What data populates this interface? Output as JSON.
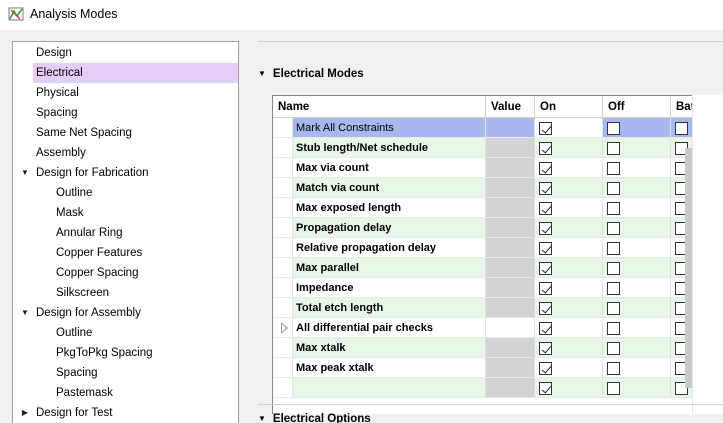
{
  "window": {
    "title": "Analysis Modes"
  },
  "tree": {
    "items": [
      {
        "label": "Design",
        "level": 0,
        "toggle": "",
        "selected": false
      },
      {
        "label": "Electrical",
        "level": 0,
        "toggle": "",
        "selected": true
      },
      {
        "label": "Physical",
        "level": 0,
        "toggle": "",
        "selected": false
      },
      {
        "label": "Spacing",
        "level": 0,
        "toggle": "",
        "selected": false
      },
      {
        "label": "Same Net Spacing",
        "level": 0,
        "toggle": "",
        "selected": false
      },
      {
        "label": "Assembly",
        "level": 0,
        "toggle": "",
        "selected": false
      },
      {
        "label": "Design for Fabrication",
        "level": 0,
        "toggle": "expanded",
        "selected": false
      },
      {
        "label": "Outline",
        "level": 1,
        "toggle": "",
        "selected": false
      },
      {
        "label": "Mask",
        "level": 1,
        "toggle": "",
        "selected": false
      },
      {
        "label": "Annular Ring",
        "level": 1,
        "toggle": "",
        "selected": false
      },
      {
        "label": "Copper Features",
        "level": 1,
        "toggle": "",
        "selected": false
      },
      {
        "label": "Copper Spacing",
        "level": 1,
        "toggle": "",
        "selected": false
      },
      {
        "label": "Silkscreen",
        "level": 1,
        "toggle": "",
        "selected": false
      },
      {
        "label": "Design for Assembly",
        "level": 0,
        "toggle": "expanded",
        "selected": false
      },
      {
        "label": "Outline",
        "level": 1,
        "toggle": "",
        "selected": false
      },
      {
        "label": "PkgToPkg Spacing",
        "level": 1,
        "toggle": "",
        "selected": false
      },
      {
        "label": "Spacing",
        "level": 1,
        "toggle": "",
        "selected": false
      },
      {
        "label": "Pastemask",
        "level": 1,
        "toggle": "",
        "selected": false
      },
      {
        "label": "Design for Test",
        "level": 0,
        "toggle": "collapsed",
        "selected": false
      }
    ]
  },
  "sections": {
    "modes_title": "Electrical Modes",
    "options_title": "Electrical Options"
  },
  "grid": {
    "columns": [
      "Name",
      "Value",
      "On",
      "Off",
      "Bat"
    ],
    "rows": [
      {
        "name": "Mark All Constraints",
        "on": true,
        "off": false,
        "batch": false,
        "highlight": true,
        "expander": false
      },
      {
        "name": "Stub length/Net schedule",
        "on": true,
        "off": false,
        "batch": false,
        "highlight": false,
        "expander": false
      },
      {
        "name": "Max via count",
        "on": true,
        "off": false,
        "batch": false,
        "highlight": false,
        "expander": false
      },
      {
        "name": "Match via count",
        "on": true,
        "off": false,
        "batch": false,
        "highlight": false,
        "expander": false
      },
      {
        "name": "Max exposed length",
        "on": true,
        "off": false,
        "batch": false,
        "highlight": false,
        "expander": false
      },
      {
        "name": "Propagation delay",
        "on": true,
        "off": false,
        "batch": false,
        "highlight": false,
        "expander": false
      },
      {
        "name": "Relative propagation delay",
        "on": true,
        "off": false,
        "batch": false,
        "highlight": false,
        "expander": false
      },
      {
        "name": "Max parallel",
        "on": true,
        "off": false,
        "batch": false,
        "highlight": false,
        "expander": false
      },
      {
        "name": "Impedance",
        "on": true,
        "off": false,
        "batch": false,
        "highlight": false,
        "expander": false
      },
      {
        "name": "Total etch length",
        "on": true,
        "off": false,
        "batch": false,
        "highlight": false,
        "expander": false
      },
      {
        "name": "All differential pair checks",
        "on": true,
        "off": false,
        "batch": false,
        "highlight": false,
        "expander": true
      },
      {
        "name": "Max xtalk",
        "on": true,
        "off": false,
        "batch": false,
        "highlight": false,
        "expander": false
      },
      {
        "name": "Max peak xtalk",
        "on": true,
        "off": false,
        "batch": false,
        "highlight": false,
        "expander": false
      },
      {
        "name": "",
        "on": true,
        "off": false,
        "batch": false,
        "highlight": false,
        "expander": false
      }
    ]
  },
  "colors": {
    "tree_selected": "#e4cdf7",
    "row_highlight": "#a7b8ee",
    "row_alt": "#e8f6e8",
    "value_cell": "#d3d3d3"
  }
}
